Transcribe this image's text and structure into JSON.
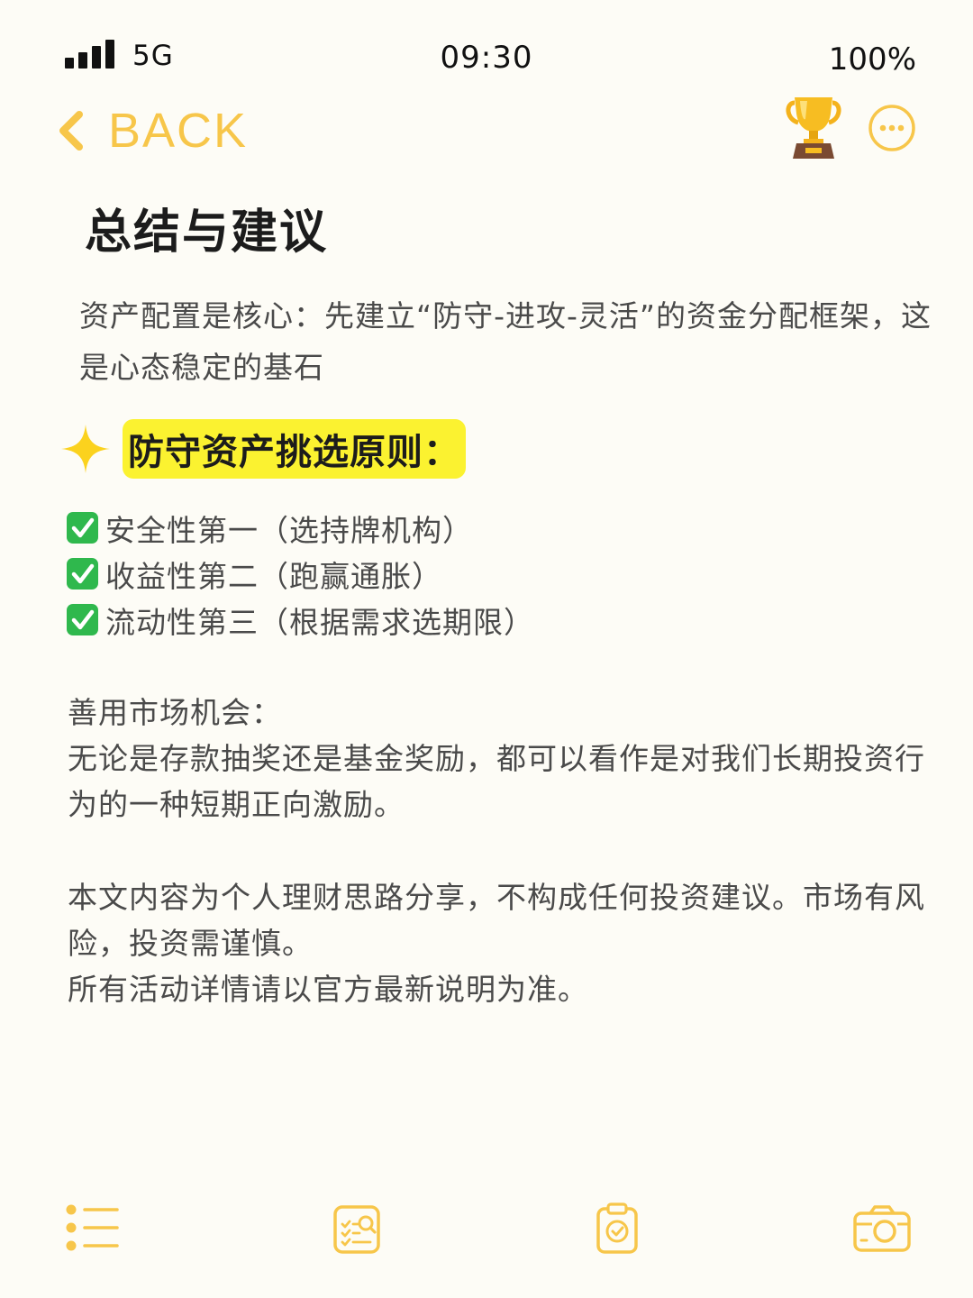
{
  "status_bar": {
    "network": "5G",
    "time": "09:30",
    "battery": "100%"
  },
  "nav": {
    "back_label": "BACK",
    "icons": [
      "chevron-left-icon",
      "trophy-icon",
      "more-icon"
    ]
  },
  "title": "总结与建议",
  "intro": "资产配置是核心：先建立“防守-进攻-灵活”的资金分配框架，这是心态稳定的基石",
  "section": {
    "icon": "sparkle-icon",
    "title": "防守资产挑选原则："
  },
  "checklist": [
    "安全性第一（选持牌机构）",
    "收益性第二（跑赢通胀）",
    "流动性第三（根据需求选期限）"
  ],
  "market": {
    "heading": "善用市场机会：",
    "body": "无论是存款抽奖还是基金奖励，都可以看作是对我们长期投资行为的一种短期正向激励。"
  },
  "disclaimer": {
    "line1": "本文内容为个人理财思路分享，不构成任何投资建议。市场有风险，投资需谨慎。",
    "line2": "所有活动详情请以官方最新说明为准。"
  },
  "tabbar": {
    "icons": [
      "list-icon",
      "checklist-search-icon",
      "clipboard-check-icon",
      "camera-icon"
    ]
  },
  "colors": {
    "accent": "#f7c64a",
    "highlight": "#fbf230",
    "check_green": "#2fb84d",
    "background": "#fdfcf6",
    "text": "#4a4a4a"
  }
}
